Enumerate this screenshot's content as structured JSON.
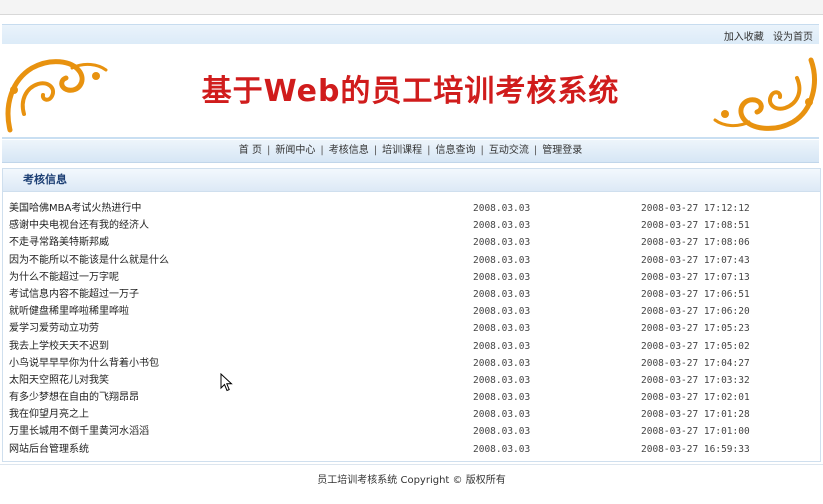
{
  "top_links": {
    "favorite": "加入收藏",
    "homepage": "设为首页"
  },
  "banner": {
    "title": "基于Web的员工培训考核系统"
  },
  "nav": {
    "items": [
      "首 页",
      "新闻中心",
      "考核信息",
      "培训课程",
      "信息查询",
      "互动交流",
      "管理登录"
    ],
    "separator": "|"
  },
  "section": {
    "heading": "考核信息",
    "rows": [
      {
        "title": "美国哈佛MBA考试火热进行中",
        "date": "2008.03.03",
        "time": "2008-03-27 17:12:12"
      },
      {
        "title": "感谢中央电视台还有我的经济人",
        "date": "2008.03.03",
        "time": "2008-03-27 17:08:51"
      },
      {
        "title": "不走寻常路美特斯邦威",
        "date": "2008.03.03",
        "time": "2008-03-27 17:08:06"
      },
      {
        "title": "因为不能所以不能该是什么就是什么",
        "date": "2008.03.03",
        "time": "2008-03-27 17:07:43"
      },
      {
        "title": "为什么不能超过一万字呢",
        "date": "2008.03.03",
        "time": "2008-03-27 17:07:13"
      },
      {
        "title": "考试信息内容不能超过一万子",
        "date": "2008.03.03",
        "time": "2008-03-27 17:06:51"
      },
      {
        "title": "就听健盘稀里哗啦稀里哗啦",
        "date": "2008.03.03",
        "time": "2008-03-27 17:06:20"
      },
      {
        "title": "爱学习爱劳动立功劳",
        "date": "2008.03.03",
        "time": "2008-03-27 17:05:23"
      },
      {
        "title": "我去上学校天天不迟到",
        "date": "2008.03.03",
        "time": "2008-03-27 17:05:02"
      },
      {
        "title": "小鸟说早早早你为什么背着小书包",
        "date": "2008.03.03",
        "time": "2008-03-27 17:04:27"
      },
      {
        "title": "太阳天空照花儿对我笑",
        "date": "2008.03.03",
        "time": "2008-03-27 17:03:32"
      },
      {
        "title": "有多少梦想在自由的飞翔昂昂",
        "date": "2008.03.03",
        "time": "2008-03-27 17:02:01"
      },
      {
        "title": "我在仰望月亮之上",
        "date": "2008.03.03",
        "time": "2008-03-27 17:01:28"
      },
      {
        "title": "万里长城用不倒千里黄河水滔滔",
        "date": "2008.03.03",
        "time": "2008-03-27 17:01:00"
      },
      {
        "title": "网站后台管理系统",
        "date": "2008.03.03",
        "time": "2008-03-27 16:59:33"
      }
    ]
  },
  "footer": {
    "text": "员工培训考核系统 Copyright © 版权所有"
  },
  "colors": {
    "title_red": "#d01c1c",
    "ornament_orange": "#e8920f",
    "heading_blue": "#1c3f74"
  },
  "icons": {
    "cursor": "mouse-pointer-icon",
    "ornament": "corner-scroll-ornament-icon"
  }
}
